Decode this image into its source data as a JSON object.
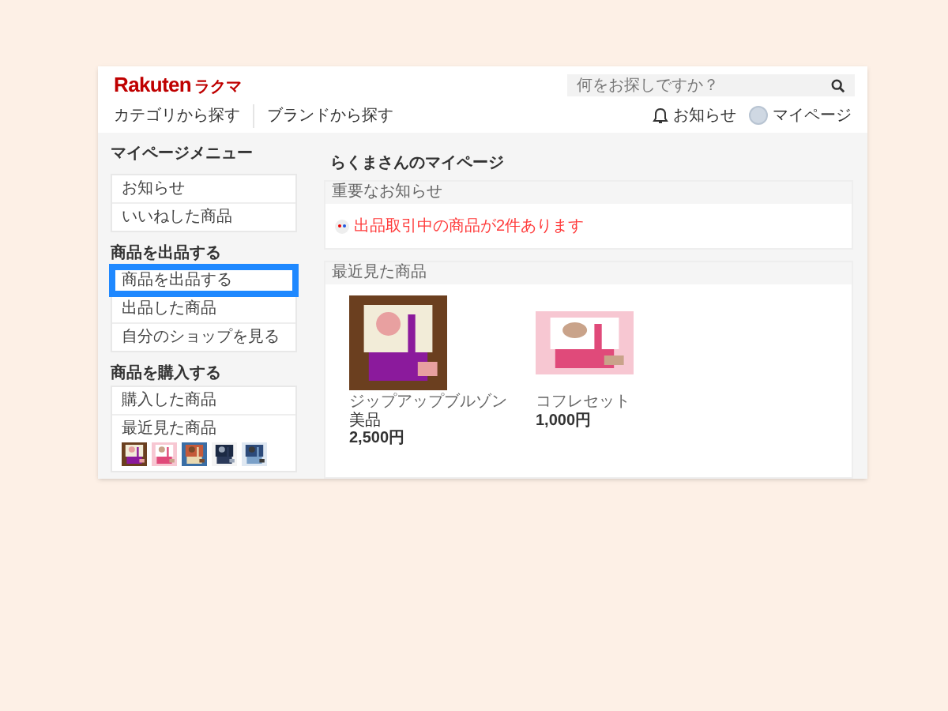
{
  "header": {
    "logo_latin": "Rakuten",
    "logo_kana": "ラクマ",
    "search": {
      "placeholder": "何をお探しですか？"
    },
    "nav": [
      "カテゴリから探す",
      "ブランドから探す"
    ],
    "notifications": "お知らせ",
    "mypage": "マイページ"
  },
  "sidebar": {
    "title": "マイページメニュー",
    "groups": [
      {
        "items": [
          {
            "label": "お知らせ",
            "selected": false
          },
          {
            "label": "いいねした商品",
            "selected": false
          }
        ]
      },
      {
        "heading": "商品を出品する",
        "items": [
          {
            "label": "商品を出品する",
            "selected": true
          },
          {
            "label": "出品した商品",
            "selected": false
          },
          {
            "label": "自分のショップを見る",
            "selected": false
          }
        ]
      },
      {
        "heading": "商品を購入する",
        "items": [
          {
            "label": "購入した商品",
            "selected": false
          },
          {
            "label": "最近見た商品",
            "selected": false
          }
        ]
      }
    ]
  },
  "main": {
    "title": "らくまさんのマイページ",
    "notice": {
      "heading": "重要なお知らせ",
      "message": "出品取引中の商品が2件あります"
    },
    "recent": {
      "heading": "最近見た商品",
      "products": [
        {
          "name": "ジップアップブルゾン",
          "condition": "美品",
          "price": "2,500円"
        },
        {
          "name": "コフレセット",
          "price": "1,000円"
        }
      ]
    }
  }
}
